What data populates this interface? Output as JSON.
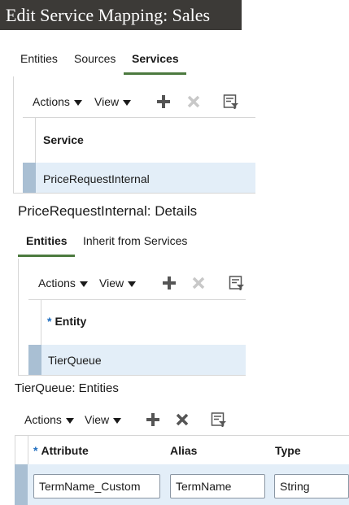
{
  "page": {
    "title": "Edit Service Mapping: Sales"
  },
  "top_tabs": [
    "Entities",
    "Sources",
    "Services"
  ],
  "top_tabs_selected": "Services",
  "toolbar": {
    "actions_label": "Actions",
    "view_label": "View"
  },
  "services_table": {
    "header": "Service",
    "rows": [
      "PriceRequestInternal"
    ]
  },
  "details": {
    "title": "PriceRequestInternal: Details",
    "tabs": [
      "Entities",
      "Inherit from Services"
    ],
    "tabs_selected": "Entities",
    "header_required_mark": "*",
    "header": "Entity",
    "rows": [
      "TierQueue"
    ]
  },
  "entities": {
    "title": "TierQueue: Entities",
    "required_mark": "*",
    "columns": [
      "Attribute",
      "Alias",
      "Type"
    ],
    "rows": [
      {
        "attribute": "TermName_Custom",
        "alias": "TermName",
        "type": "String"
      }
    ]
  },
  "colors": {
    "title_bg": "#3c3a37",
    "tab_underline": "#4c7a3f",
    "selected_row": "#e3eef8",
    "required_star": "#1e6dbf"
  }
}
